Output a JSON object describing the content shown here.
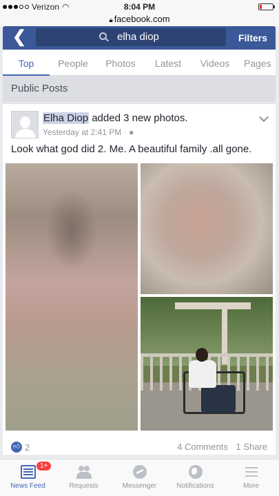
{
  "status_bar": {
    "carrier": "Verizon",
    "time": "8:04 PM",
    "wifi_icon": "wifi-icon",
    "battery_icon": "battery-low-icon"
  },
  "browser": {
    "url": "facebook.com",
    "lock_icon": "lock-icon"
  },
  "header": {
    "back_icon": "back-arrow-icon",
    "search_icon": "search-icon",
    "search_query": "elha diop",
    "filters_label": "Filters",
    "brand_color": "#3b5998"
  },
  "tabs": [
    {
      "label": "Top",
      "active": true
    },
    {
      "label": "People"
    },
    {
      "label": "Photos"
    },
    {
      "label": "Latest"
    },
    {
      "label": "Videos"
    },
    {
      "label": "Pages"
    }
  ],
  "section_title": "Public Posts",
  "post": {
    "author": "Elha Diop",
    "action": "added 3 new photos.",
    "timestamp": "Yesterday at 2:41 PM",
    "privacy_icon": "globe-icon",
    "text": "Look what god did 2. Me. A beautiful family .all gone.",
    "like_count": "2",
    "comments": "4 Comments",
    "shares": "1 Share"
  },
  "bottom_nav": [
    {
      "label": "News Feed",
      "icon": "news-feed-icon",
      "badge": "1+",
      "active": true
    },
    {
      "label": "Requests",
      "icon": "friend-requests-icon"
    },
    {
      "label": "Messenger",
      "icon": "messenger-icon"
    },
    {
      "label": "Notifications",
      "icon": "notifications-globe-icon"
    },
    {
      "label": "More",
      "icon": "menu-icon"
    }
  ]
}
